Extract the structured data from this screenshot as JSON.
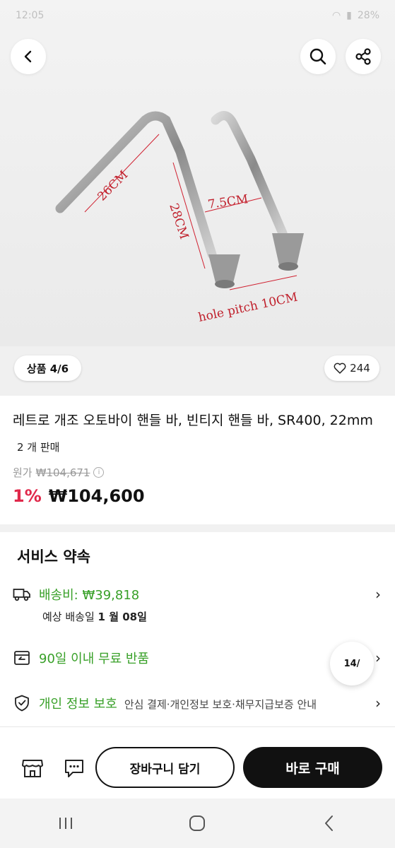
{
  "status_bar": {
    "time": "12:05",
    "battery": "28%"
  },
  "hero": {
    "labels": {
      "a": "26CM",
      "b": "28CM",
      "c": "7.5CM",
      "d": "hole pitch 10CM"
    },
    "counter": "상품 4/6",
    "likes": "244"
  },
  "product": {
    "title": "레트로 개조 오토바이 핸들 바, 빈티지 핸들 바, SR400, 22mm",
    "sold": "2 개 판매",
    "original_label": "원가",
    "original_price": "₩104,671",
    "discount": "1%",
    "price": "₩104,600"
  },
  "service": {
    "title": "서비스 약속",
    "shipping_label": "배송비: ₩39,818",
    "delivery_prefix": "예상 배송일 ",
    "delivery_date": "1 월 08일",
    "return_label": "90일 이내 무료 반품",
    "privacy_label": "개인 정보 보호",
    "privacy_desc": "안심 결제·개인정보 보호·채무지급보증 안내"
  },
  "float_badge": "14/",
  "actions": {
    "cart": "장바구니 담기",
    "buy": "바로 구매"
  },
  "colors": {
    "green": "#38a028",
    "discount": "#e0284a",
    "dark": "#111111"
  }
}
